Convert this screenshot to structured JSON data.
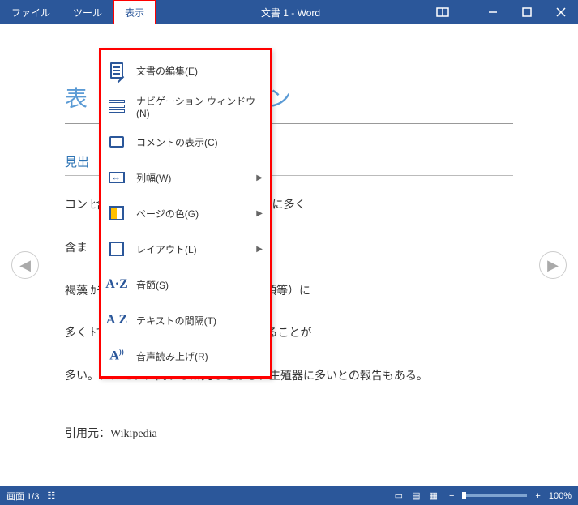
{
  "titlebar": {
    "menus": [
      "ファイル",
      "ツール",
      "表示"
    ],
    "active_index": 2,
    "title": "文書 1  -  Word"
  },
  "dropdown": {
    "items": [
      {
        "label": "文書の編集(E)",
        "icon": "doc-edit-icon",
        "has_sub": false
      },
      {
        "label": "ナビゲーション ウィンドウ(N)",
        "icon": "nav-pane-icon",
        "has_sub": false
      },
      {
        "label": "コメントの表示(C)",
        "icon": "comments-icon",
        "has_sub": false
      },
      {
        "label": "列幅(W)",
        "icon": "column-width-icon",
        "has_sub": true
      },
      {
        "label": "ページの色(G)",
        "icon": "page-color-icon",
        "has_sub": true
      },
      {
        "label": "レイアウト(L)",
        "icon": "layout-icon",
        "has_sub": true
      },
      {
        "label": "音節(S)",
        "icon": "syllable-icon",
        "has_sub": false
      },
      {
        "label": "テキストの間隔(T)",
        "icon": "text-spacing-icon",
        "has_sub": false
      },
      {
        "label": "音声読み上げ(R)",
        "icon": "text-to-speech-icon",
        "has_sub": false
      }
    ]
  },
  "document": {
    "title_visible": "表                                         ンとフコダイン",
    "heading": "見出",
    "para1": "コン                                                                        ﾋ含む）、モズクなど褐藻類の粘質物に多く",
    "para2": "含ま",
    "para3": "褐藻                                                                        ｶモク、ウミトラノオ等ホンダワラ類等）に",
    "para4": "多く                                                                       ﾄて海藻のネバネバ成分と表現されることが",
    "para5": "多い。アカモクに関する研究などから、生殖器に多いとの報告もある。",
    "source": "引用元：Wikipedia"
  },
  "statusbar": {
    "page_counter": "画面 1/3",
    "zoom_label": "100%",
    "zoom_minus": "−",
    "zoom_plus": "+"
  }
}
